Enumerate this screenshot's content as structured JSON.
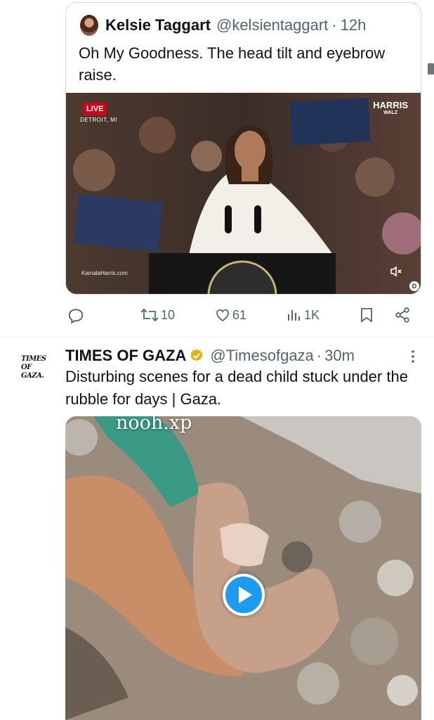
{
  "quoted_tweet": {
    "author_name": "Kelsie Taggart",
    "handle": "@kelsientaggart",
    "separator": "·",
    "time": "12h",
    "text": "Oh My Goodness. The head tilt and eyebrow raise.",
    "media": {
      "live_badge": "LIVE",
      "location": "DETROIT, MI",
      "brand_top": "HARRIS",
      "brand_bottom": "WALZ",
      "source": "KamalaHarris.com",
      "mute_icon": "speaker-muted-icon",
      "corner_badge": "D"
    }
  },
  "actions": {
    "reply": {
      "icon": "reply-icon",
      "count": ""
    },
    "repost": {
      "icon": "repost-icon",
      "count": "10"
    },
    "like": {
      "icon": "heart-icon",
      "count": "61"
    },
    "views": {
      "icon": "views-icon",
      "count": "1K"
    },
    "bookmark": {
      "icon": "bookmark-icon"
    },
    "share": {
      "icon": "share-icon"
    }
  },
  "tweet": {
    "avatar_logo_lines": [
      "TIMES",
      "OF",
      "GAZA."
    ],
    "author_name": "TIMES OF GAZA",
    "verified_icon": "gold-verified-badge-icon",
    "handle": "@Timesofgaza",
    "separator": "·",
    "time": "30m",
    "more_icon": "more-vertical-icon",
    "text": "Disturbing scenes for a dead child stuck under the rubble for days | Gaza.",
    "media": {
      "watermark": "nooh.xp",
      "play_icon": "play-icon"
    }
  },
  "colors": {
    "text_primary": "#0f1419",
    "text_secondary": "#536471",
    "border": "#cfd9de",
    "accent": "#1d9bf0",
    "verified_gold": "#e2b719",
    "live_red": "#d0021b"
  }
}
